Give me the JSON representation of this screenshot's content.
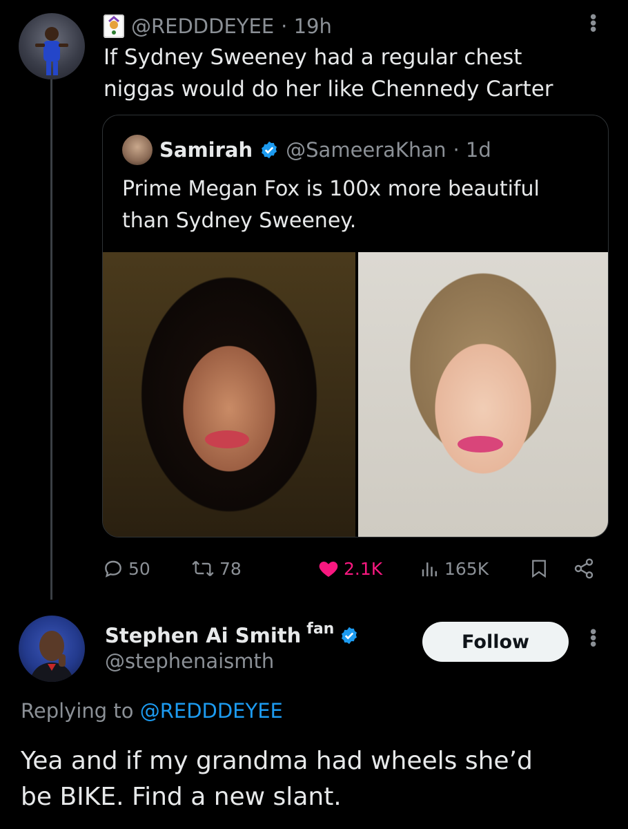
{
  "colors": {
    "background": "#000000",
    "text_primary": "#e7e9ea",
    "text_secondary": "#8b9096",
    "like_pink": "#f91880",
    "verified_blue": "#1d9bf0",
    "follow_bg": "#eff3f4"
  },
  "tweet": {
    "handle": "@REDDDEYEE",
    "time": "· 19h",
    "text": "If Sydney Sweeney had a regular chest\nniggas would do her like Chennedy Carter",
    "more_icon": "more-vertical-icon",
    "quote": {
      "name": "Samirah",
      "handle": "@SameeraKhan",
      "time": "· 1d",
      "text": "Prime Megan Fox is 100x more beautiful\nthan Sydney Sweeney.",
      "verified_icon": "verified-badge-icon"
    },
    "actions": {
      "replies": "50",
      "retweets": "78",
      "likes": "2.1K",
      "views": "165K"
    }
  },
  "reply": {
    "name": "Stephen Ai Smith",
    "badge": "fan",
    "handle": "@stephenaismth",
    "follow_label": "Follow",
    "replying_prefix": "Replying to",
    "replying_handle": "@REDDDEYEE",
    "text": "Yea and if my grandma had wheels she’d\nbe BIKE. Find a new slant."
  }
}
